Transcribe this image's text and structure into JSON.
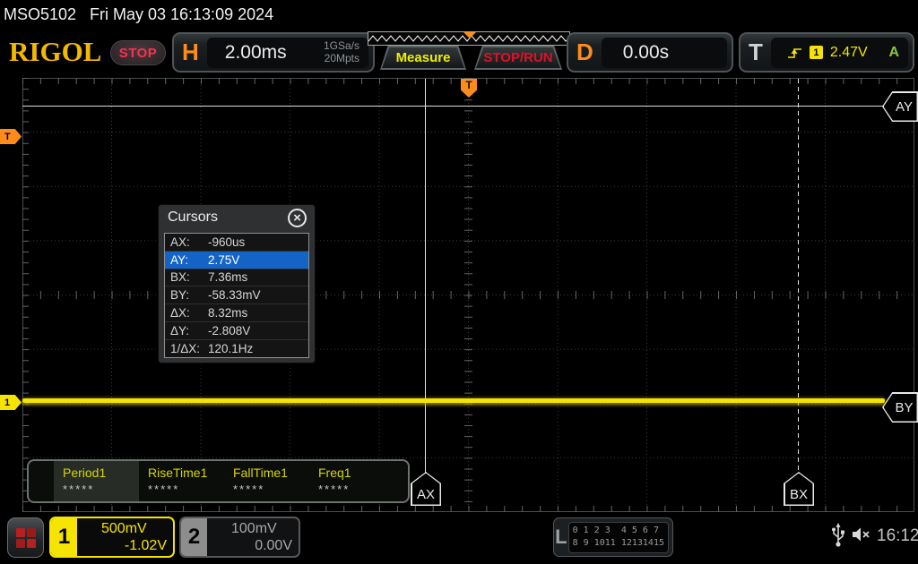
{
  "status_bar": {
    "model": "MSO5102",
    "datetime": "Fri May 03 16:13:09 2024"
  },
  "header": {
    "logo": "RIGOL",
    "run_state": "STOP",
    "horizontal": {
      "label": "H",
      "timebase": "2.00ms",
      "sample_rate": "1GSa/s",
      "memory_depth": "20Mpts"
    },
    "measure_button": "Measure",
    "stop_run_button": "STOP/RUN",
    "delay": {
      "label": "D",
      "value": "0.00s"
    },
    "trigger": {
      "label": "T",
      "source_channel": "1",
      "level": "2.47V",
      "sweep_mode": "A"
    }
  },
  "cursors_panel": {
    "title": "Cursors",
    "close_icon": "×",
    "rows": [
      {
        "label": "AX:",
        "value": "-960us"
      },
      {
        "label": "AY:",
        "value": "2.75V"
      },
      {
        "label": "BX:",
        "value": "7.36ms"
      },
      {
        "label": "BY:",
        "value": "-58.33mV"
      },
      {
        "label": "ΔX:",
        "value": "8.32ms"
      },
      {
        "label": "ΔY:",
        "value": "-2.808V"
      },
      {
        "label": "1/ΔX:",
        "value": "120.1Hz"
      }
    ]
  },
  "graticule": {
    "trigger_position_badge": "T",
    "trigger_level_marker": "T",
    "channel1_marker": "1",
    "cursor_tags": {
      "ay": "AY",
      "by": "BY",
      "ax": "AX",
      "bx": "BX"
    }
  },
  "measurements": {
    "items": [
      {
        "name": "Period1",
        "value": "*****"
      },
      {
        "name": "RiseTime1",
        "value": "*****"
      },
      {
        "name": "FallTime1",
        "value": "*****"
      },
      {
        "name": "Freq1",
        "value": "*****"
      }
    ]
  },
  "bottom_bar": {
    "channel1": {
      "number": "1",
      "scale": "500mV",
      "offset": "-1.02V"
    },
    "channel2": {
      "number": "2",
      "scale": "100mV",
      "offset": "0.00V"
    },
    "logic": {
      "label": "L",
      "row1": "0 1 2 3  4 5 6 7",
      "row2": "8 9 1011 12131415"
    },
    "clock": "16:12"
  },
  "colors": {
    "channel1_yellow": "#f5e400",
    "trigger_orange": "#ff8c1a",
    "run_red": "#e01028",
    "sweep_green": "#8cc63f",
    "selection_blue": "#1464c8",
    "logo_gold": "#f3b800"
  }
}
